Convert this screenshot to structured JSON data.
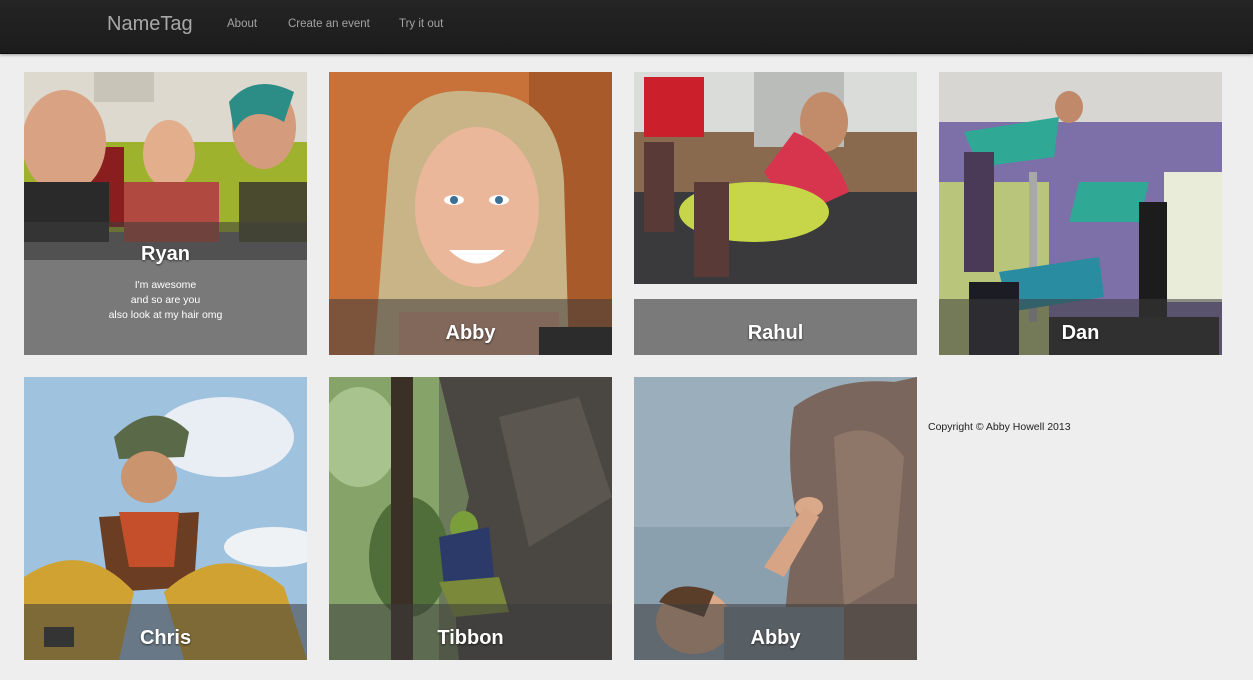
{
  "navbar": {
    "brand": "NameTag",
    "links": [
      "About",
      "Create an event",
      "Try it out"
    ]
  },
  "tiles": [
    {
      "name": "Ryan",
      "bio": [
        "I'm awesome",
        "and so are you",
        "also look at my hair omg"
      ]
    },
    {
      "name": "Abby"
    },
    {
      "name": "Rahul"
    },
    {
      "name": "Dan"
    },
    {
      "name": "Chris"
    },
    {
      "name": "Tibbon"
    },
    {
      "name": "Abby"
    }
  ],
  "footer": {
    "copyright": "Copyright © Abby Howell 2013"
  }
}
